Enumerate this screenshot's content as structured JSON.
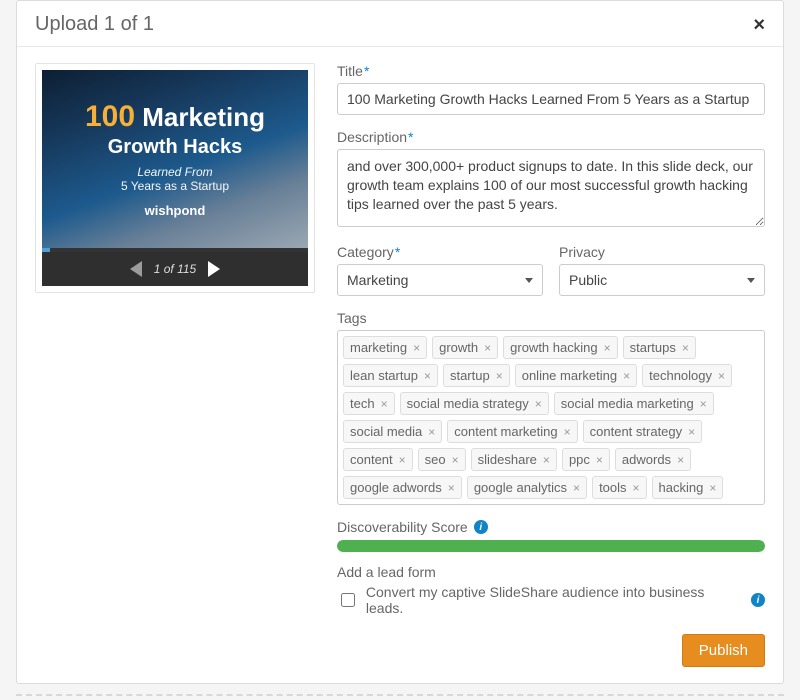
{
  "header": {
    "title": "Upload 1 of 1"
  },
  "preview": {
    "slide_line1_num": "100",
    "slide_line1_rest": " Marketing",
    "slide_line2": "Growth Hacks",
    "slide_line3": "Learned From",
    "slide_line4": "5 Years as a Startup",
    "slide_brand": "wishpond",
    "counter": "1 of 115"
  },
  "form": {
    "title_label": "Title",
    "title_value": "100 Marketing Growth Hacks Learned From 5 Years as a Startup",
    "description_label": "Description",
    "description_value": "and over 300,000+ product signups to date. In this slide deck, our growth team explains 100 of our most successful growth hacking tips learned over the past 5 years.",
    "category_label": "Category",
    "category_value": "Marketing",
    "privacy_label": "Privacy",
    "privacy_value": "Public",
    "tags_label": "Tags",
    "tags": [
      "marketing",
      "growth",
      "growth hacking",
      "startups",
      "lean startup",
      "startup",
      "online marketing",
      "technology",
      "tech",
      "social media strategy",
      "social media marketing",
      "social media",
      "content marketing",
      "content strategy",
      "content",
      "seo",
      "slideshare",
      "ppc",
      "adwords",
      "google adwords",
      "google analytics",
      "tools",
      "hacking"
    ],
    "discoverability_label": "Discoverability Score",
    "discoverability_percent": 100,
    "lead_form_label": "Add a lead form",
    "lead_form_text": "Convert my captive SlideShare audience into business leads.",
    "lead_form_checked": false
  },
  "footer": {
    "publish_label": "Publish"
  }
}
